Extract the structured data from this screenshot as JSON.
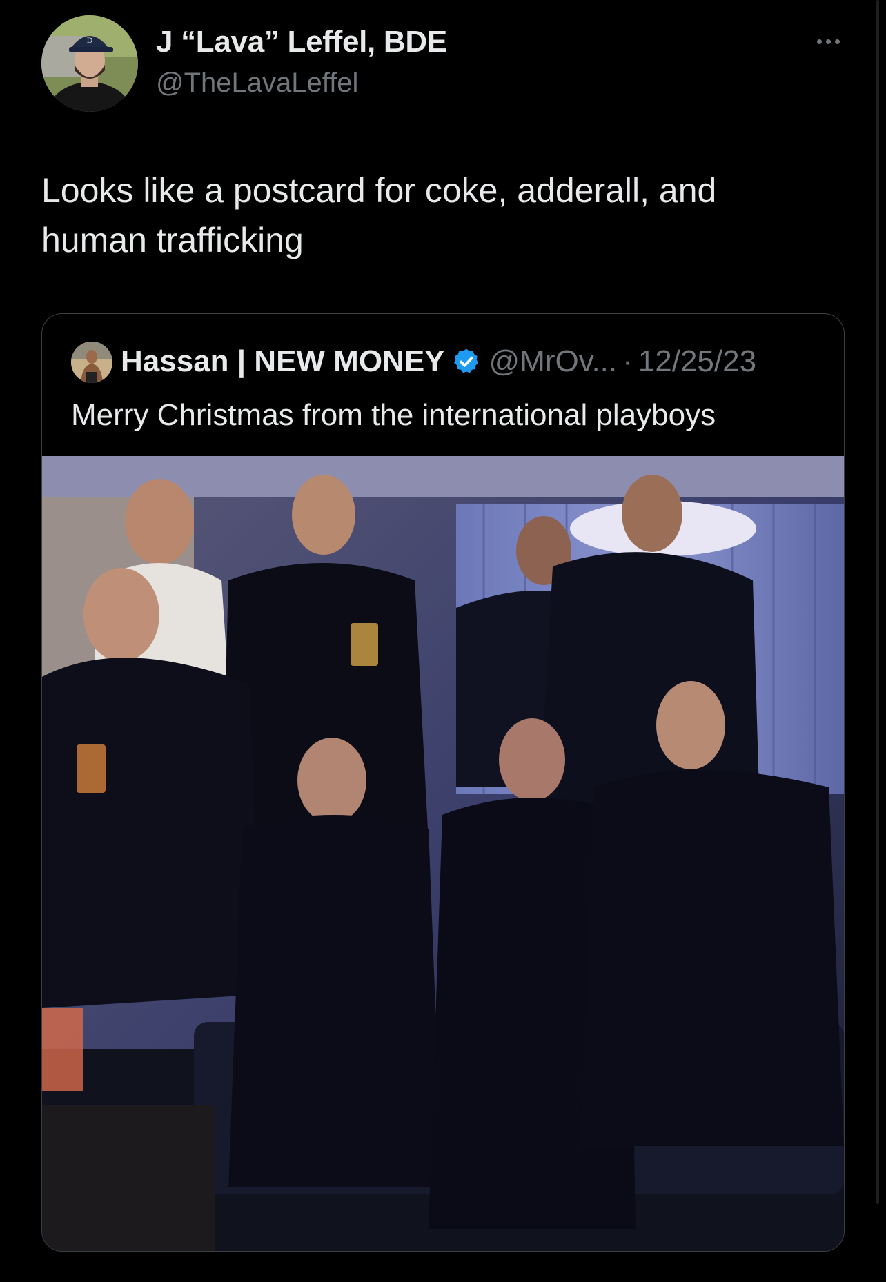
{
  "tweet": {
    "author_name": "J “Lava” Leffel, BDE",
    "author_handle": "@TheLavaLeffel",
    "text": "Looks like a postcard for coke, adderall, and human trafficking",
    "more_icon": "ellipsis-icon"
  },
  "quoted_tweet": {
    "author_name": "Hassan | NEW MONEY",
    "verified": true,
    "author_handle": "@MrOv...",
    "separator": "·",
    "date": "12/25/23",
    "text": "Merry Christmas from the international playboys",
    "photo_icon": "group-photo"
  },
  "colors": {
    "background": "#000000",
    "primary_text": "#e7e9ea",
    "secondary_text": "#71767b",
    "border": "#3a3f44",
    "verified_badge": "#1d9bf0"
  }
}
